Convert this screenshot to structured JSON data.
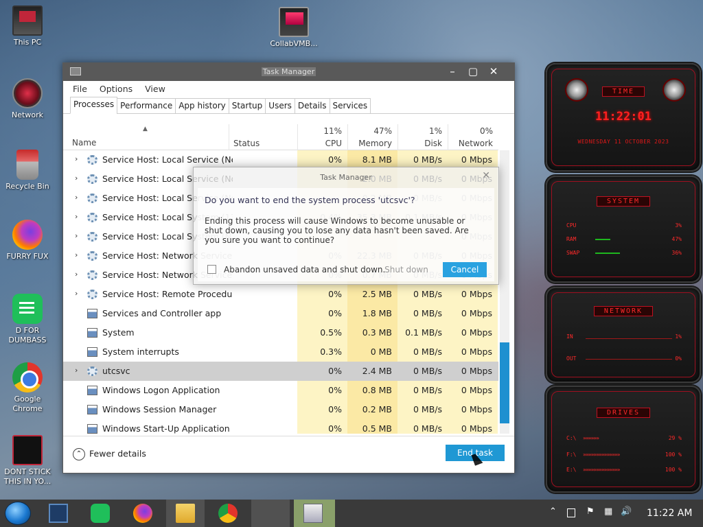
{
  "desktop": {
    "icons": [
      {
        "label": "This PC"
      },
      {
        "label": "Network"
      },
      {
        "label": "Recycle Bin"
      },
      {
        "label": "FURRY FUX"
      },
      {
        "label": "D FOR DUMBASS"
      },
      {
        "label": "Google Chrome"
      },
      {
        "label": "DONT STICK THIS IN YO..."
      },
      {
        "label": "CollabVMB..."
      }
    ]
  },
  "task_manager": {
    "title": "Task Manager",
    "menu": [
      "File",
      "Options",
      "View"
    ],
    "tabs": [
      "Processes",
      "Performance",
      "App history",
      "Startup",
      "Users",
      "Details",
      "Services"
    ],
    "active_tab": "Processes",
    "columns": {
      "name": "Name",
      "status": "Status",
      "cpu": {
        "pct": "11%",
        "label": "CPU"
      },
      "memory": {
        "pct": "47%",
        "label": "Memory"
      },
      "disk": {
        "pct": "1%",
        "label": "Disk"
      },
      "network": {
        "pct": "0%",
        "label": "Network"
      }
    },
    "rows": [
      {
        "name": "Service Host: Local Service (Net...",
        "cpu": "0%",
        "mem": "8.1 MB",
        "disk": "0 MB/s",
        "net": "0 Mbps",
        "expand": true,
        "icon": "gear"
      },
      {
        "name": "Service Host: Local Service (No I...",
        "cpu": "",
        "mem": "2.0 MB",
        "disk": "0 MB/s",
        "net": "0 Mbps",
        "expand": true,
        "icon": "gear"
      },
      {
        "name": "Service Host: Local Service (No...",
        "cpu": "",
        "mem": "0.2 MB",
        "disk": "0 MB/s",
        "net": "0 Mbps",
        "expand": true,
        "icon": "gear"
      },
      {
        "name": "Service Host: Local System (13)",
        "cpu": "0.4%",
        "mem": "35.3 MB",
        "disk": "0.1 MB/s",
        "net": "0 Mbps",
        "expand": true,
        "icon": "gear"
      },
      {
        "name": "Service Host: Local System (N...",
        "cpu": "",
        "mem": "",
        "disk": "",
        "net": "0 Mbps",
        "expand": true,
        "icon": "gear"
      },
      {
        "name": "Service Host: Network Service (4)",
        "cpu": "0%",
        "mem": "22.3 MB",
        "disk": "0 MB/s",
        "net": "0 Mbps",
        "expand": true,
        "icon": "gear"
      },
      {
        "name": "Service Host: Network Service (...",
        "cpu": "0%",
        "mem": "0.7 MB",
        "disk": "0 MB/s",
        "net": "0 Mbps",
        "expand": true,
        "icon": "gear"
      },
      {
        "name": "Service Host: Remote Procedure...",
        "cpu": "0%",
        "mem": "2.5 MB",
        "disk": "0 MB/s",
        "net": "0 Mbps",
        "expand": true,
        "icon": "gear"
      },
      {
        "name": "Services and Controller app",
        "cpu": "0%",
        "mem": "1.8 MB",
        "disk": "0 MB/s",
        "net": "0 Mbps",
        "expand": false,
        "icon": "app"
      },
      {
        "name": "System",
        "cpu": "0.5%",
        "mem": "0.3 MB",
        "disk": "0.1 MB/s",
        "net": "0 Mbps",
        "expand": false,
        "icon": "app"
      },
      {
        "name": "System interrupts",
        "cpu": "0.3%",
        "mem": "0 MB",
        "disk": "0 MB/s",
        "net": "0 Mbps",
        "expand": false,
        "icon": "app"
      },
      {
        "name": "utcsvc",
        "cpu": "0%",
        "mem": "2.4 MB",
        "disk": "0 MB/s",
        "net": "0 Mbps",
        "expand": true,
        "icon": "gear",
        "selected": true
      },
      {
        "name": "Windows Logon Application",
        "cpu": "0%",
        "mem": "0.8 MB",
        "disk": "0 MB/s",
        "net": "0 Mbps",
        "expand": false,
        "icon": "app"
      },
      {
        "name": "Windows Session Manager",
        "cpu": "0%",
        "mem": "0.2 MB",
        "disk": "0 MB/s",
        "net": "0 Mbps",
        "expand": false,
        "icon": "app"
      },
      {
        "name": "Windows Start-Up Application",
        "cpu": "0%",
        "mem": "0.5 MB",
        "disk": "0 MB/s",
        "net": "0 Mbps",
        "expand": false,
        "icon": "app"
      }
    ],
    "fewer_details": "Fewer details",
    "end_task": "End task"
  },
  "dialog": {
    "title": "Task Manager",
    "question": "Do you want to end the system process 'utcsvc'?",
    "message": "Ending this process will cause Windows to become unusable or shut down, causing you to lose any data hasn't been saved. Are you sure you want to continue?",
    "checkbox_label": "Abandon unsaved data and shut down.",
    "shutdown_label": "Shut down",
    "cancel_label": "Cancel"
  },
  "gadget": {
    "time_header": "TIME",
    "time": "11:22:01",
    "date": "WEDNESDAY 11 OCTOBER 2023",
    "system_header": "SYSTEM",
    "system": [
      {
        "label": "CPU",
        "value": "3%",
        "level": 0.03
      },
      {
        "label": "RAM",
        "value": "47%",
        "level": 0.47
      },
      {
        "label": "SWAP",
        "value": "36%",
        "level": 0.36
      }
    ],
    "network_header": "NETWORK",
    "network": [
      {
        "label": "IN",
        "value": "1%"
      },
      {
        "label": "OUT",
        "value": "0%"
      }
    ],
    "drives_header": "DRIVES",
    "drives": [
      {
        "label": "C:\\",
        "value": "29 %"
      },
      {
        "label": "F:\\",
        "value": "100 %"
      },
      {
        "label": "E:\\",
        "value": "100 %"
      }
    ]
  },
  "taskbar": {
    "clock": "11:22 AM",
    "items": [
      "start",
      "task-view",
      "d-for-dumbass",
      "firefox",
      "file-explorer",
      "chrome",
      "blank",
      "task-manager"
    ]
  },
  "colors": {
    "accent": "#1f98d4",
    "gadget_red": "#ff2a2a",
    "cpu_col": "#fdf4c5",
    "mem_col": "#fbe9a5"
  }
}
